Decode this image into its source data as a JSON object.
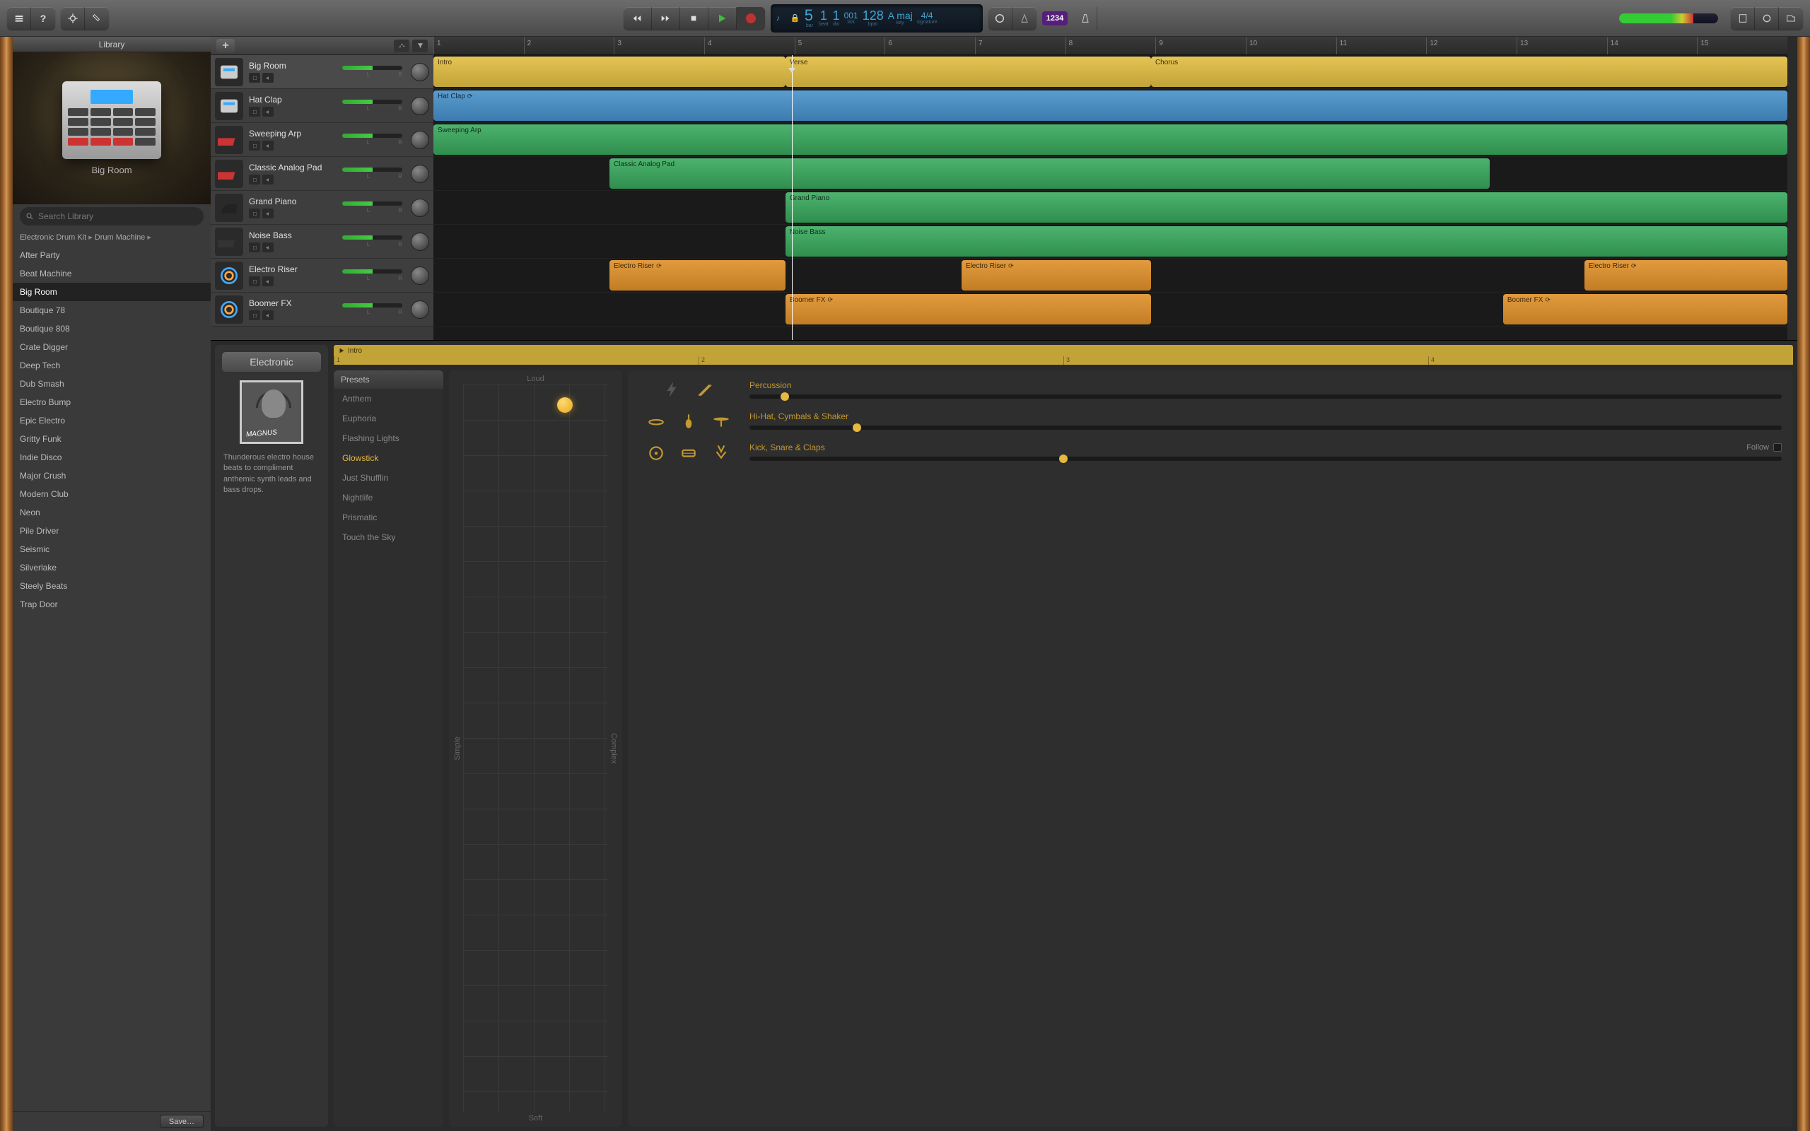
{
  "toolbar": {
    "lcd": {
      "bar": "5",
      "beat": "1",
      "div": "1",
      "tick": "001",
      "bpm": "128",
      "key": "A maj",
      "sig": "4/4",
      "bar_lbl": "bar",
      "beat_lbl": "beat",
      "div_lbl": "div",
      "tick_lbl": "tick",
      "bpm_lbl": "bpm",
      "key_lbl": "key",
      "sig_lbl": "signature"
    },
    "count_in": "1234"
  },
  "library": {
    "title": "Library",
    "preview_name": "Big Room",
    "search_placeholder": "Search Library",
    "breadcrumb": [
      "Electronic Drum Kit",
      "Drum Machine"
    ],
    "items": [
      "After Party",
      "Beat Machine",
      "Big Room",
      "Boutique 78",
      "Boutique 808",
      "Crate Digger",
      "Deep Tech",
      "Dub Smash",
      "Electro Bump",
      "Epic Electro",
      "Gritty Funk",
      "Indie Disco",
      "Major Crush",
      "Modern Club",
      "Neon",
      "Pile Driver",
      "Seismic",
      "Silverlake",
      "Steely Beats",
      "Trap Door"
    ],
    "selected": "Big Room",
    "save_label": "Save…"
  },
  "tracks": [
    {
      "name": "Big Room",
      "icon": "drum-machine"
    },
    {
      "name": "Hat Clap",
      "icon": "drum-machine"
    },
    {
      "name": "Sweeping Arp",
      "icon": "synth-red"
    },
    {
      "name": "Classic Analog Pad",
      "icon": "synth-red"
    },
    {
      "name": "Grand Piano",
      "icon": "piano"
    },
    {
      "name": "Noise Bass",
      "icon": "synth-dark"
    },
    {
      "name": "Electro Riser",
      "icon": "fx"
    },
    {
      "name": "Boomer FX",
      "icon": "fx"
    }
  ],
  "ruler": [
    1,
    2,
    3,
    4,
    5,
    6,
    7,
    8,
    9,
    10,
    11,
    12,
    13,
    14,
    15
  ],
  "regions": {
    "lane0": [
      {
        "name": "Intro",
        "cls": "reg-yellow",
        "l": 0,
        "w": 26
      },
      {
        "name": "Verse",
        "cls": "reg-yellow",
        "l": 26,
        "w": 27
      },
      {
        "name": "Chorus",
        "cls": "reg-yellow",
        "l": 53,
        "w": 47
      }
    ],
    "lane1": [
      {
        "name": "Hat Clap",
        "cls": "reg-blue",
        "l": 0,
        "w": 100,
        "loop": true
      }
    ],
    "lane2": [
      {
        "name": "Sweeping Arp",
        "cls": "reg-green",
        "l": 0,
        "w": 100
      }
    ],
    "lane3": [
      {
        "name": "Classic Analog Pad",
        "cls": "reg-green",
        "l": 13,
        "w": 65
      }
    ],
    "lane4": [
      {
        "name": "Grand Piano",
        "cls": "reg-green",
        "l": 26,
        "w": 74
      }
    ],
    "lane5": [
      {
        "name": "Noise Bass",
        "cls": "reg-green",
        "l": 26,
        "w": 74
      }
    ],
    "lane6": [
      {
        "name": "Electro Riser",
        "cls": "reg-orange",
        "l": 13,
        "w": 13,
        "loop": true
      },
      {
        "name": "Electro Riser",
        "cls": "reg-orange",
        "l": 39,
        "w": 14,
        "loop": true
      },
      {
        "name": "Electro Riser",
        "cls": "reg-orange",
        "l": 85,
        "w": 15,
        "loop": true
      }
    ],
    "lane7": [
      {
        "name": "Boomer FX",
        "cls": "reg-orange",
        "l": 26,
        "w": 27,
        "loop": true
      },
      {
        "name": "Boomer FX",
        "cls": "reg-orange",
        "l": 79,
        "w": 21,
        "loop": true
      }
    ]
  },
  "playhead_pct": 26.5,
  "editor": {
    "tab": "Electronic",
    "avatar_sig": "MAGNUS",
    "description": "Thunderous electro house beats to compliment anthemic synth leads and bass drops.",
    "region_label": "Intro",
    "ruler": [
      1,
      2,
      3,
      4
    ],
    "presets_hdr": "Presets",
    "presets": [
      "Anthem",
      "Euphoria",
      "Flashing Lights",
      "Glowstick",
      "Just Shufflin",
      "Nightlife",
      "Prismatic",
      "Touch the Sky"
    ],
    "preset_selected": "Glowstick",
    "pad_labels": {
      "top": "Loud",
      "bottom": "Soft",
      "left": "Simple",
      "right": "Complex"
    },
    "drum_rows": [
      {
        "label": "Percussion",
        "pos": 3,
        "icons": [
          "bolt",
          "sticks"
        ]
      },
      {
        "label": "Hi-Hat, Cymbals & Shaker",
        "pos": 10,
        "icons": [
          "tambourine",
          "shaker",
          "cymbal"
        ]
      },
      {
        "label": "Kick, Snare & Claps",
        "pos": 30,
        "icons": [
          "kick",
          "snare",
          "clap"
        ]
      }
    ],
    "follow_label": "Follow"
  }
}
